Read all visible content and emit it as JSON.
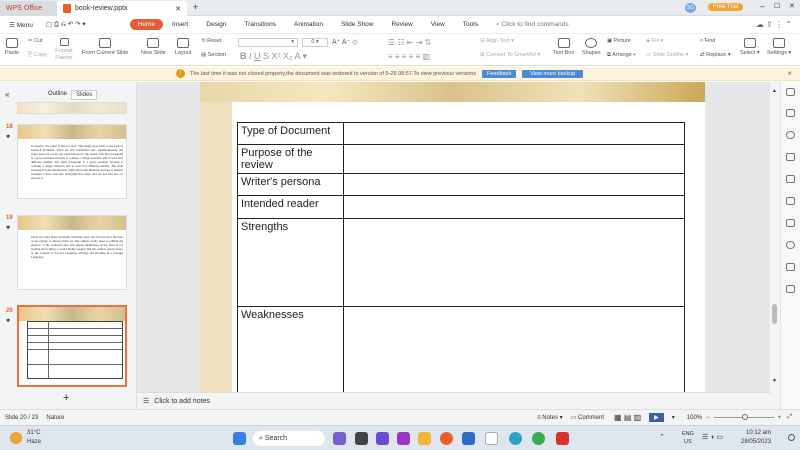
{
  "titlebar": {
    "app_tab": "WPS Office",
    "doc_tab": "book-review.pptx",
    "user_initials": "SG",
    "free_trial": "Free Trial"
  },
  "menu": {
    "menu_label": "Menu",
    "items": [
      "Home",
      "Insert",
      "Design",
      "Transitions",
      "Animation",
      "Slide Show",
      "Review",
      "View",
      "Tools"
    ],
    "search": "Click to find commands"
  },
  "ribbon": {
    "paste": "Paste",
    "cut": "Cut",
    "copy": "Copy",
    "format_painter": "Format Painter",
    "from_current": "From Current Slide",
    "new_slide": "New Slide",
    "layout": "Layout",
    "reset": "Reset",
    "section": "Section",
    "font_size": "0",
    "align_text": "Align Text",
    "convert_smartart": "Convert To SmartArt",
    "text_box": "Text Box",
    "shapes": "Shapes",
    "picture": "Picture",
    "arrange": "Arrange",
    "fill": "Fill",
    "slide_outline": "Slide Outline",
    "find": "Find",
    "replace": "Replace",
    "select": "Select",
    "settings": "Settings"
  },
  "notice": {
    "message": "The last time it was not closed properly,the document was restored to version of 5-26 08:57.To view previous versions",
    "feedback": "Feedback",
    "view_backup": "View more backup"
  },
  "panel": {
    "outline_tab": "Outline",
    "slides_tab": "Slides"
  },
  "thumbnails": [
    {
      "num": "18",
      "text": "In general, the paper is hard to read. This likely goes back to the lack of research problems. There are few transitions and, organizationally, the paper does not set up any expectations for the reader. The first paragraph is a great example because it contains a single sentence and at least five different themes. The third paragraph is a great example because it contains a single sentence and at least five different themes. The final paragraph in the introduction (right before the Methods section) is another example. I have read that paragraph five times and am not sure how to process it."
    },
    {
      "num": "19",
      "text": "There are other major problems with this paper, but I do not have the time or the energy to discuss them all. The authors really need to rethink the purpose of the collected data and situate themselves in the field of L2 reading and writing. I would highly suggest that the authors reread issues of the Journal of Second Language Writing and Reading in a Foreign Language."
    },
    {
      "num": "20"
    }
  ],
  "slide": {
    "rows": [
      "Type of Document",
      "Purpose of the review",
      "Writer's persona",
      "Intended reader",
      "Strengths",
      "Weaknesses"
    ]
  },
  "notes": {
    "placeholder": "Click to add notes"
  },
  "status": {
    "slide_count": "Slide 20 / 23",
    "theme": "Nature",
    "notes": "Notes",
    "comment": "Comment",
    "zoom": "100%"
  },
  "taskbar": {
    "temp": "31°C",
    "weather": "Haze",
    "search": "Search",
    "lang1": "ENG",
    "lang2": "US",
    "time": "10:12 am",
    "date": "28/05/2023"
  }
}
